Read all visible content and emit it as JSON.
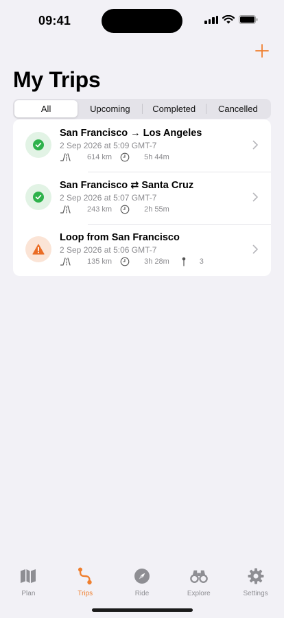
{
  "status_bar": {
    "time": "09:41"
  },
  "header": {
    "title": "My Trips",
    "add_icon": "plus-icon"
  },
  "segments": [
    {
      "label": "All",
      "active": true
    },
    {
      "label": "Upcoming",
      "active": false
    },
    {
      "label": "Completed",
      "active": false
    },
    {
      "label": "Cancelled",
      "active": false
    }
  ],
  "trips": [
    {
      "title": "San Francisco → Los Angeles",
      "date": "2 Sep 2026 at 5:09 GMT-7",
      "distance": "614 km",
      "duration": "5h 44m",
      "stops": null,
      "status": "completed",
      "status_color": "#2fb24c"
    },
    {
      "title": "San Francisco ⇄ Santa Cruz",
      "date": "2 Sep 2026 at 5:07 GMT-7",
      "distance": "243 km",
      "duration": "2h 55m",
      "stops": null,
      "status": "completed",
      "status_color": "#2fb24c"
    },
    {
      "title": "Loop from San Francisco",
      "date": "2 Sep 2026 at 5:06 GMT-7",
      "distance": "135 km",
      "duration": "3h 28m",
      "stops": "3",
      "status": "warning",
      "status_color": "#ea6c25"
    }
  ],
  "tabs": [
    {
      "label": "Plan",
      "icon": "map-icon",
      "active": false
    },
    {
      "label": "Trips",
      "icon": "route-icon",
      "active": true
    },
    {
      "label": "Ride",
      "icon": "compass-icon",
      "active": false
    },
    {
      "label": "Explore",
      "icon": "binoculars-icon",
      "active": false
    },
    {
      "label": "Settings",
      "icon": "gear-icon",
      "active": false
    }
  ],
  "colors": {
    "accent": "#ef7f2e",
    "success": "#2fb24c",
    "warning": "#ea6c25",
    "background": "#f2f1f6"
  }
}
